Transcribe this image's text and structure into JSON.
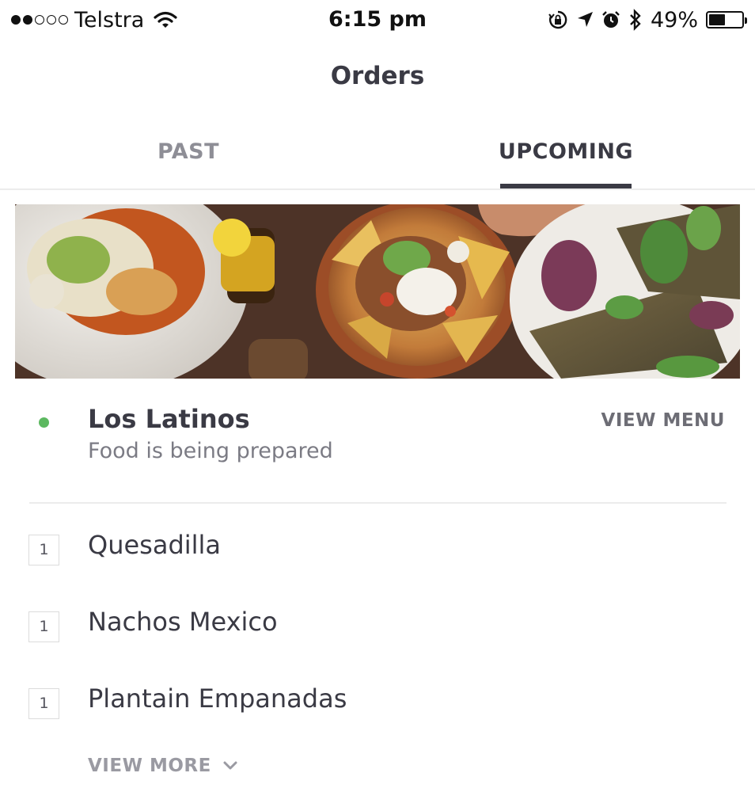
{
  "status_bar": {
    "carrier": "Telstra",
    "time": "6:15 pm",
    "battery_percent": "49%",
    "battery_level": 0.49,
    "signal_bars_filled": 2,
    "signal_bars_total": 5
  },
  "header": {
    "title": "Orders"
  },
  "tabs": [
    {
      "label": "PAST",
      "active": false
    },
    {
      "label": "UPCOMING",
      "active": true
    }
  ],
  "order": {
    "restaurant": "Los Latinos",
    "status": "Food is being prepared",
    "status_color": "#5cb860",
    "view_menu_label": "VIEW MENU",
    "items": [
      {
        "qty": "1",
        "name": "Quesadilla"
      },
      {
        "qty": "1",
        "name": "Nachos Mexico"
      },
      {
        "qty": "1",
        "name": "Plantain Empanadas"
      }
    ],
    "view_more_label": "VIEW MORE"
  }
}
